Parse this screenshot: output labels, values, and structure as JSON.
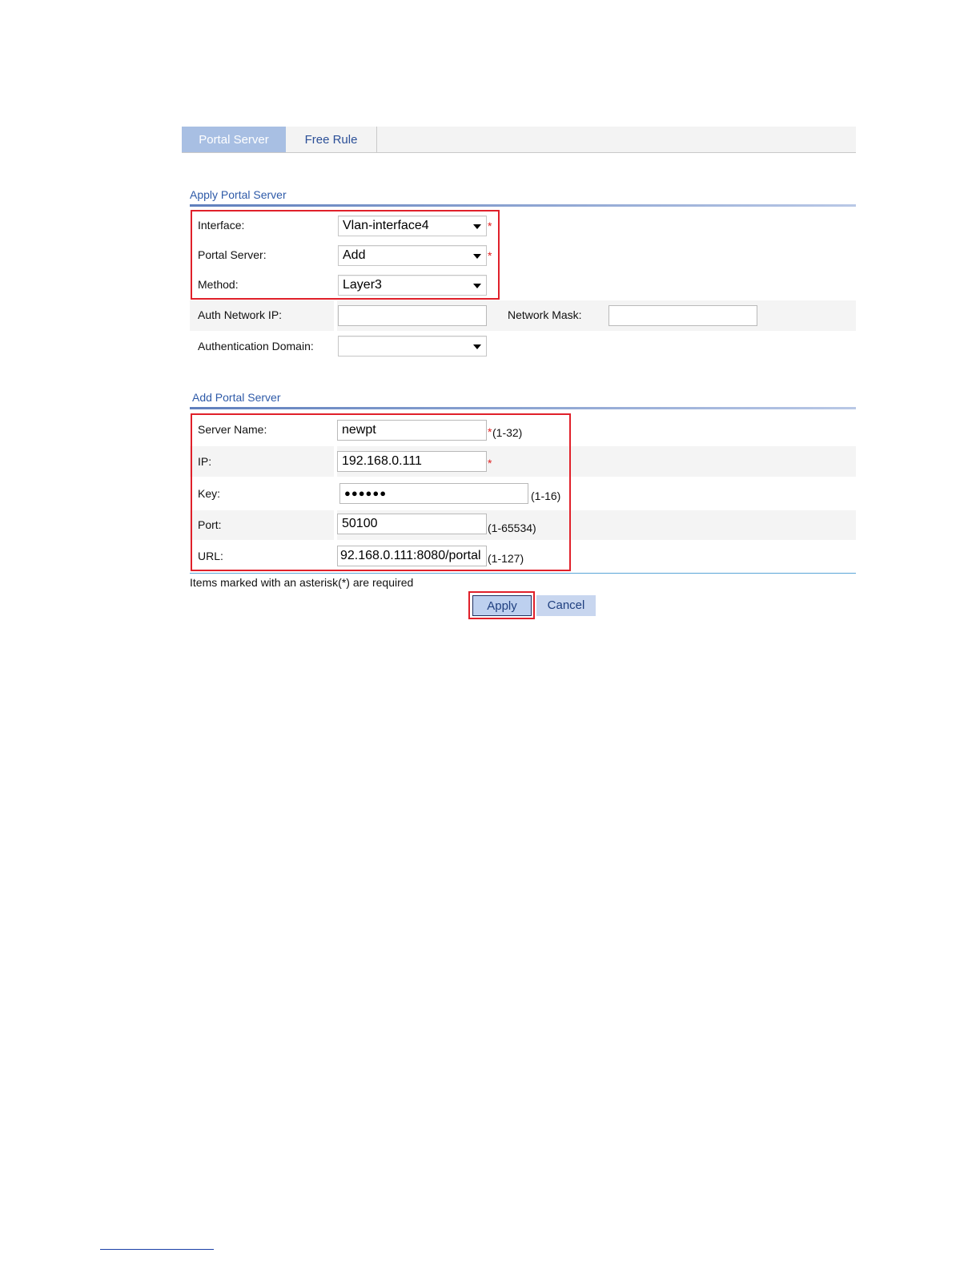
{
  "tabs": [
    {
      "label": "Portal Server"
    },
    {
      "label": "Free Rule"
    }
  ],
  "apply_section": {
    "title": "Apply Portal Server",
    "interface": {
      "label": "Interface:",
      "value": "Vlan-interface4",
      "required": "*"
    },
    "portal_server": {
      "label": "Portal Server:",
      "value": "Add",
      "required": "*"
    },
    "method": {
      "label": "Method:",
      "value": "Layer3"
    },
    "auth_network_ip": {
      "label": "Auth Network IP:",
      "value": ""
    },
    "network_mask": {
      "label": "Network Mask:",
      "value": ""
    },
    "auth_domain": {
      "label": "Authentication Domain:",
      "value": ""
    }
  },
  "add_section": {
    "title": "Add Portal Server",
    "server_name": {
      "label": "Server Name:",
      "value": "newpt",
      "required": "*",
      "hint": "(1-32)"
    },
    "ip": {
      "label": "IP:",
      "value": "192.168.0.111",
      "required": "*"
    },
    "key": {
      "label": "Key:",
      "value": "●●●●●●",
      "hint": "(1-16)"
    },
    "port": {
      "label": "Port:",
      "value": "50100",
      "hint": "(1-65534)"
    },
    "url": {
      "label": "URL:",
      "value": "92.168.0.111:8080/portal",
      "hint": "(1-127)"
    }
  },
  "footer_note": "Items marked with an asterisk(*) are required",
  "buttons": {
    "apply": "Apply",
    "cancel": "Cancel"
  },
  "colors": {
    "highlight": "#e0202a",
    "tab_active": "#a8bfe3",
    "link": "#2e5aa8"
  }
}
